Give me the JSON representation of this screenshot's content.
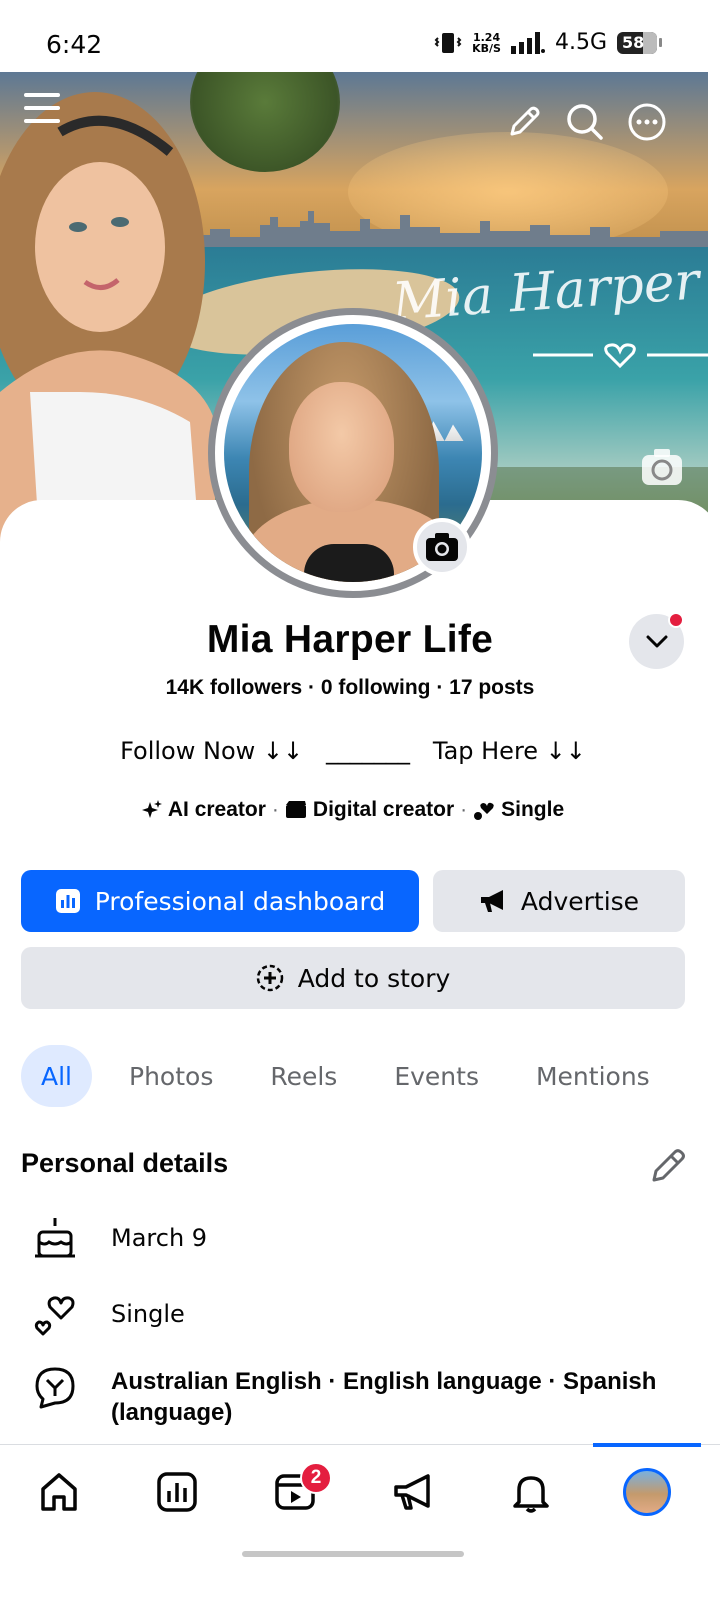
{
  "status_bar": {
    "time": "6:42",
    "net_speed_value": "1.24",
    "net_speed_unit": "KB/S",
    "network": "4.5G",
    "battery": "58"
  },
  "cover": {
    "script_name": "Mia Harper"
  },
  "profile": {
    "name": "Mia Harper Life",
    "stats": "14K followers · 0 following · 17 posts",
    "bio": "Follow Now ↓↓   _______   Tap Here ↓↓",
    "tags": [
      "AI creator",
      "Digital creator",
      "Single"
    ],
    "tag_separator": "·"
  },
  "actions": {
    "professional_dashboard": "Professional dashboard",
    "advertise": "Advertise",
    "add_to_story": "Add to story"
  },
  "tabs": [
    "All",
    "Photos",
    "Reels",
    "Events",
    "Mentions"
  ],
  "active_tab": "All",
  "personal_details": {
    "title": "Personal details",
    "birthday": "March 9",
    "relationship": "Single",
    "languages": "Australian English · English language · Spanish (language)"
  },
  "bottom_nav": {
    "items": [
      "home-icon",
      "dashboard-icon",
      "video-icon",
      "megaphone-icon",
      "bell-icon",
      "profile-avatar"
    ],
    "video_badge": "2"
  },
  "colors": {
    "accent": "#0866ff",
    "secondary_button": "#e4e6eb",
    "badge": "#e41e3f",
    "muted_text": "#65676b"
  }
}
